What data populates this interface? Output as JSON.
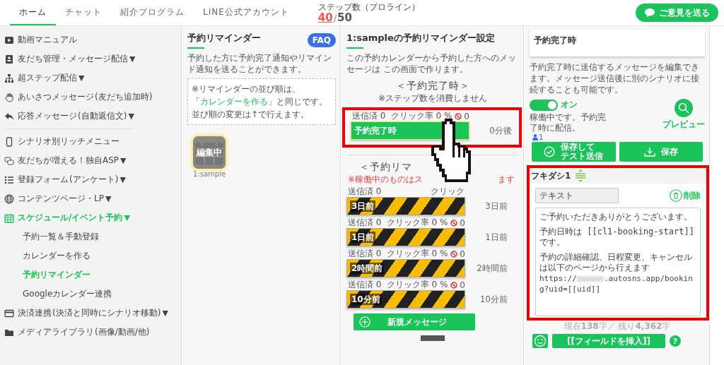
{
  "nav": {
    "tabs": [
      {
        "label": "ホーム",
        "selected": true
      },
      {
        "label": "チャット",
        "selected": false
      },
      {
        "label": "紹介プログラム",
        "selected": false
      },
      {
        "label": "LINE公式アカウント",
        "selected": false
      }
    ],
    "step_label": "ステップ数（プロライン）",
    "step_used": "40",
    "step_sep": "/",
    "step_total": "50",
    "feedback_button": "ご意見を送る"
  },
  "sidebar": {
    "groups": [
      [
        {
          "label": "動画マニュアル",
          "selected": false
        },
        {
          "label": "友だち管理・メッセージ配信",
          "caret": "▼",
          "selected": false
        },
        {
          "label": "超ステップ配信",
          "caret": "▼",
          "selected": false
        },
        {
          "label": "あいさつメッセージ",
          "suffix": "(友だち追加時)",
          "selected": false
        },
        {
          "label": "応答メッセージ",
          "suffix": "(自動返信文)",
          "caret": "▼",
          "selected": false
        }
      ],
      [
        {
          "label": "シナリオ別リッチメニュー",
          "selected": false
        },
        {
          "label": "友だちが増える！独自ASP",
          "caret": "▼",
          "selected": false
        },
        {
          "label": "登録フォーム",
          "suffix": "(アンケート)",
          "caret": "▼",
          "selected": false
        },
        {
          "label": "コンテンツページ・LP",
          "caret": "▼",
          "selected": false
        },
        {
          "label": "スケジュール/イベント予約",
          "caret": "▼",
          "selected": true,
          "children": [
            {
              "label": "予約一覧＆手動登録",
              "selected": false
            },
            {
              "label": "カレンダーを作る",
              "selected": false
            },
            {
              "label": "予約リマインダー",
              "selected": true
            },
            {
              "label": "Googleカレンダー連携",
              "selected": false
            }
          ]
        },
        {
          "label": "決済連携",
          "suffix": "(決済と同時にシナリオ移動)",
          "caret": "▼",
          "selected": false
        },
        {
          "label": "メディアライブラリ",
          "suffix": "(画像/動画/他)",
          "selected": false
        }
      ]
    ]
  },
  "reminder_list": {
    "title": "予約リマインダー",
    "faq": "FAQ",
    "description": "予約した方に予約完了通知やリマインド通知を送ることができます。",
    "note_line1": "※リマインダーの並び順は、",
    "note_open": "「",
    "note_link": "カレンダーを作る",
    "note_close": "」と同じです。",
    "note_line3": "並び順の変更は↑で行えます。",
    "calendars": [
      {
        "badge": "編集中",
        "caption": "1:sample",
        "selected": true
      }
    ]
  },
  "settings": {
    "title": "1:sampleの予約リマインダー設定",
    "description": "この予約カレンダーから予約した方へのメッセージは この画面で作ります。",
    "complete": {
      "heading": "＜予約完了時＞",
      "subheading": "※ステップ数を消費しません",
      "messages": [
        {
          "kind": "complete",
          "sent": "送信済 0",
          "click": "クリック率 0 %",
          "blocked": "0",
          "label": "予約完了時",
          "timing": "0分後"
        }
      ]
    },
    "reminders": {
      "heading": "＜予約リマ",
      "note_start": "※稼働中のものはス",
      "note_end": "ます",
      "messages": [
        {
          "kind": "reminder",
          "sent": "送信済 0",
          "click": "クリック",
          "label": "3日前",
          "timing": "3日前"
        },
        {
          "kind": "reminder",
          "sent": "送信済 0",
          "click": "クリック率 0 %",
          "blocked": "0",
          "label": "1日前",
          "timing": "1日前"
        },
        {
          "kind": "reminder",
          "sent": "送信済 0",
          "click": "クリック率 0 %",
          "blocked": "0",
          "label": "2時間前",
          "timing": "2時間前"
        },
        {
          "kind": "reminder",
          "sent": "送信済 0",
          "click": "クリック率 0 %",
          "blocked": "0",
          "label": "10分前",
          "timing": "10分前"
        }
      ]
    },
    "new_button": "新規メッセージ"
  },
  "editor": {
    "header": "予約完了時",
    "description": "予約完了時に送信するメッセージを編集できます。メッセージ送信後に別のシナリオに接続することも可能です。",
    "active": true,
    "toggle_label": "オン",
    "status": "稼働中です。予約完了時に配信。",
    "preview": "プレビュー",
    "recipients": "1",
    "save_test_line1": "保存して",
    "save_test_line2": "テスト送信",
    "save": "保存",
    "bubble": {
      "title": "フキダシ1",
      "type": "テキスト",
      "delete": "削除",
      "paragraphs": [
        "ご予約いただきありがとうございます。",
        "予約日時は [[cl1-booking-start]] です。",
        "予約の詳細確認、日程変更、キャンセルは以下のページから行えます"
      ],
      "url_before": "https://",
      "url_after": ".autosns.app/booking?uid=[[uid]]"
    },
    "counter": "現在**138**字／ 残り**4,362**字",
    "insert_field": "[[フィールドを挿入]]",
    "help": "?"
  }
}
